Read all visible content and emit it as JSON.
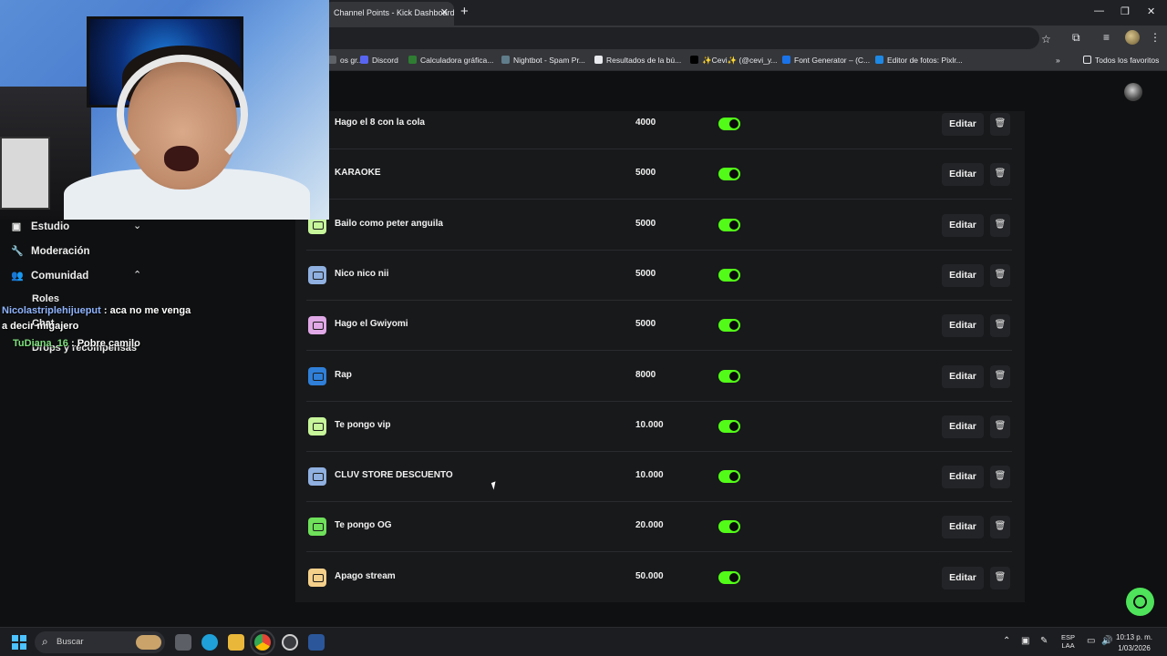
{
  "browser": {
    "tab_title": "Channel Points - Kick Dashboard",
    "tab_close": "✕",
    "new_tab": "+",
    "window_minimize": "—",
    "window_restore": "❐",
    "window_close": "✕",
    "bookmarks": [
      {
        "label": "os gr...",
        "color": "#5f6368"
      },
      {
        "label": "Discord",
        "color": "#5865f2"
      },
      {
        "label": "Calculadora gráfica...",
        "color": "#2e7d32"
      },
      {
        "label": "Nightbot - Spam Pr...",
        "color": "#607d8b"
      },
      {
        "label": "Resultados de la bú...",
        "color": "#e8eaed"
      },
      {
        "label": "✨Cevi✨ (@cevi_y...",
        "color": "#000000"
      },
      {
        "label": "Font Generator – (C...",
        "color": "#1a73e8"
      },
      {
        "label": "Editor de fotos: Pixlr...",
        "color": "#1e88e5"
      }
    ],
    "bookmarks_overflow": "»",
    "all_bookmarks": "Todos los favoritos"
  },
  "sidebar": {
    "items": [
      {
        "label": "Estudio",
        "icon": "studio-icon",
        "glyph": "▣",
        "chevron": "⌄"
      },
      {
        "label": "Moderación",
        "icon": "wrench-icon",
        "glyph": "🔧"
      },
      {
        "label": "Comunidad",
        "icon": "community-icon",
        "glyph": "👥",
        "chevron": "⌃"
      }
    ],
    "subitems": [
      "Roles",
      "Chat",
      "Drops y recompensas"
    ]
  },
  "chat": [
    {
      "user": "Nicolastriplehijueput",
      "text": " : aca no me venga"
    },
    {
      "user": "",
      "text": "a decir migajero"
    },
    {
      "user": "TuDiana_16",
      "text": " : Pobre camilo"
    }
  ],
  "rewards": [
    {
      "title": "Hago el 8 con la cola",
      "cost": "4000",
      "icon_color": "#b7f0a0"
    },
    {
      "title": "KARAOKE",
      "cost": "5000",
      "icon_color": "#9ab8e6"
    },
    {
      "title": "Bailo como peter anguila",
      "cost": "5000",
      "icon_color": "#c6f59a"
    },
    {
      "title": "Nico nico nii",
      "cost": "5000",
      "icon_color": "#8fb0e0"
    },
    {
      "title": "Hago el Gwiyomi",
      "cost": "5000",
      "icon_color": "#e0a8e6"
    },
    {
      "title": "Rap",
      "cost": "8000",
      "icon_color": "#2f7fd8"
    },
    {
      "title": "Te pongo vip",
      "cost": "10.000",
      "icon_color": "#c6f59a"
    },
    {
      "title": "CLUV STORE DESCUENTO",
      "cost": "10.000",
      "icon_color": "#8fb0e0"
    },
    {
      "title": "Te pongo OG",
      "cost": "20.000",
      "icon_color": "#6ee05a"
    },
    {
      "title": "Apago stream",
      "cost": "50.000",
      "icon_color": "#f5d08a"
    }
  ],
  "actions": {
    "edit_label": "Editar",
    "delete_glyph": "🗑"
  },
  "taskbar": {
    "search_placeholder": "Buscar",
    "lang_top": "ESP",
    "lang_bottom": "LAA",
    "time": "10:13 p. m.",
    "date": "1/03/2026",
    "tray_chevron": "⌃"
  }
}
